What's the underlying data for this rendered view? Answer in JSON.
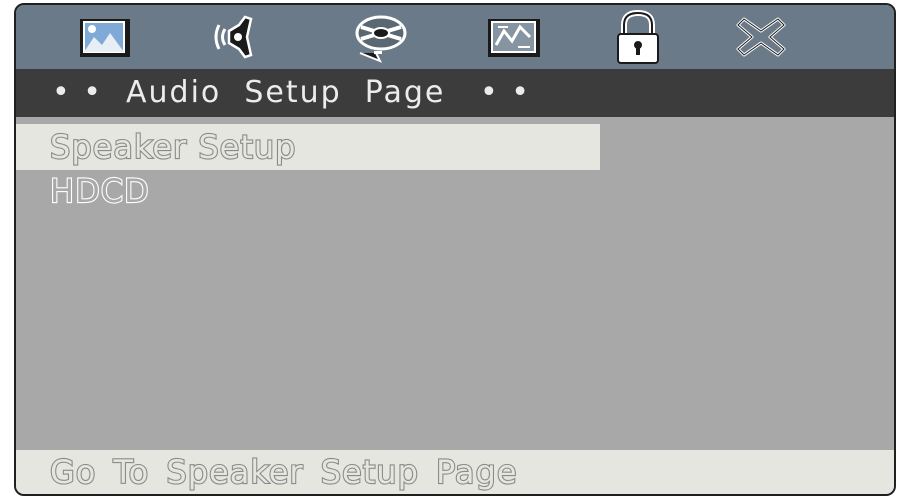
{
  "icons": [
    {
      "name": "picture-icon",
      "selected": false
    },
    {
      "name": "speaker-audio-icon",
      "selected": true
    },
    {
      "name": "video-reel-icon",
      "selected": false
    },
    {
      "name": "preferences-icon",
      "selected": false
    },
    {
      "name": "lock-icon",
      "selected": false
    },
    {
      "name": "exit-icon",
      "selected": false
    }
  ],
  "title": {
    "text": "• •  Audio  Setup  Page   • •"
  },
  "menu": {
    "items": [
      {
        "label": "Speaker Setup",
        "selected": true
      },
      {
        "label": "HDCD",
        "selected": false
      }
    ]
  },
  "status": {
    "text": "Go To Speaker Setup Page"
  },
  "colors": {
    "icon_bar": "#6b7a88",
    "title_bar": "#3c3c3c",
    "body": "#a8a8a8",
    "highlight": "#e6e6e0"
  }
}
